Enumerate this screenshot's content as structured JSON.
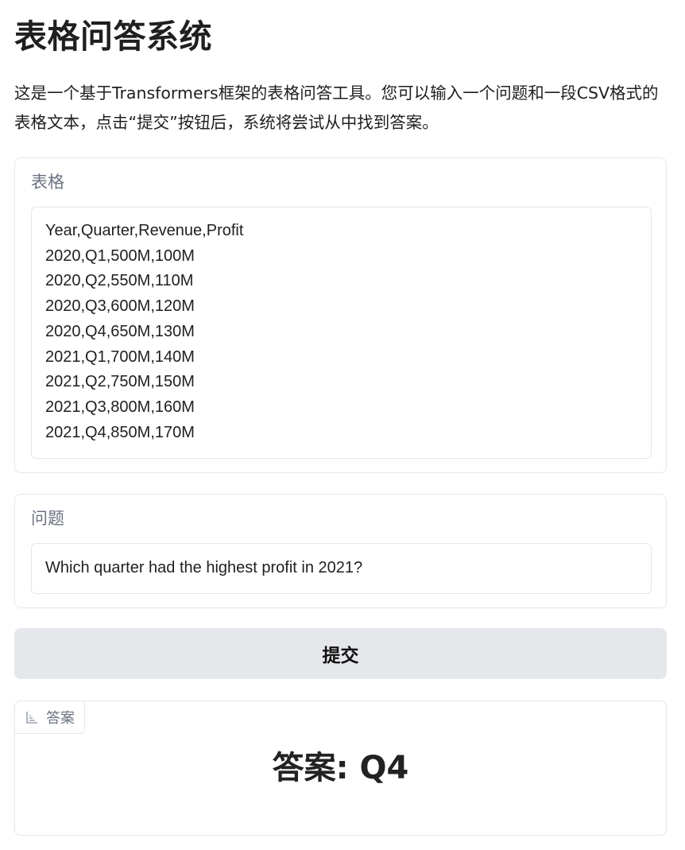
{
  "header": {
    "title": "表格问答系统",
    "description": "这是一个基于Transformers框架的表格问答工具。您可以输入一个问题和一段CSV格式的表格文本，点击“提交”按钮后，系统将尝试从中找到答案。"
  },
  "table_input": {
    "label": "表格",
    "value": "Year,Quarter,Revenue,Profit\n2020,Q1,500M,100M\n2020,Q2,550M,110M\n2020,Q3,600M,120M\n2020,Q4,650M,130M\n2021,Q1,700M,140M\n2021,Q2,750M,150M\n2021,Q3,800M,160M\n2021,Q4,850M,170M"
  },
  "question_input": {
    "label": "问题",
    "value": "Which quarter had the highest profit in 2021?"
  },
  "submit": {
    "label": "提交"
  },
  "answer": {
    "tab_label": "答案",
    "tab_icon": "output-icon",
    "text": "答案: Q4"
  }
}
